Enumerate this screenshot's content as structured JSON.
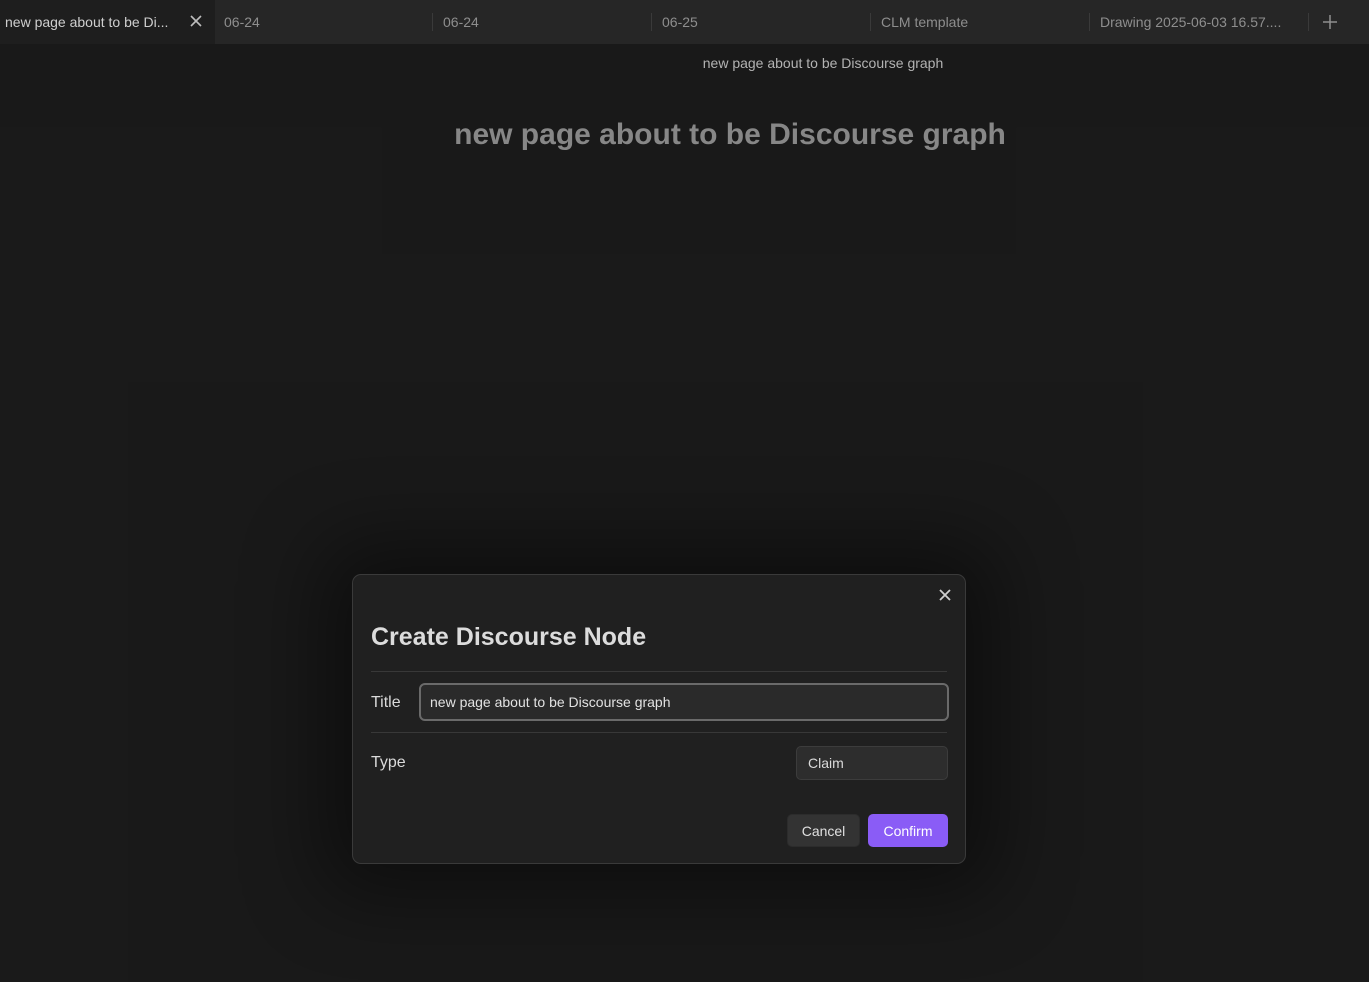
{
  "tabs": [
    {
      "label": "new page about to be Di...",
      "active": true
    },
    {
      "label": "06-24",
      "active": false
    },
    {
      "label": "06-24",
      "active": false
    },
    {
      "label": "06-25",
      "active": false
    },
    {
      "label": "CLM template",
      "active": false
    },
    {
      "label": "Drawing 2025-06-03 16.57....",
      "active": false
    }
  ],
  "page": {
    "header_title": "new page about to be Discourse graph",
    "title": "new page about to be Discourse graph"
  },
  "modal": {
    "heading": "Create Discourse Node",
    "title_label": "Title",
    "title_value": "new page about to be Discourse graph",
    "type_label": "Type",
    "type_value": "Claim",
    "cancel_label": "Cancel",
    "confirm_label": "Confirm"
  },
  "colors": {
    "accent": "#8a5cf6",
    "background": "#1b1b1b",
    "tabbar": "#262626"
  },
  "icons": {
    "tab_close": "close-icon",
    "new_tab": "plus-icon",
    "modal_close": "close-icon"
  }
}
